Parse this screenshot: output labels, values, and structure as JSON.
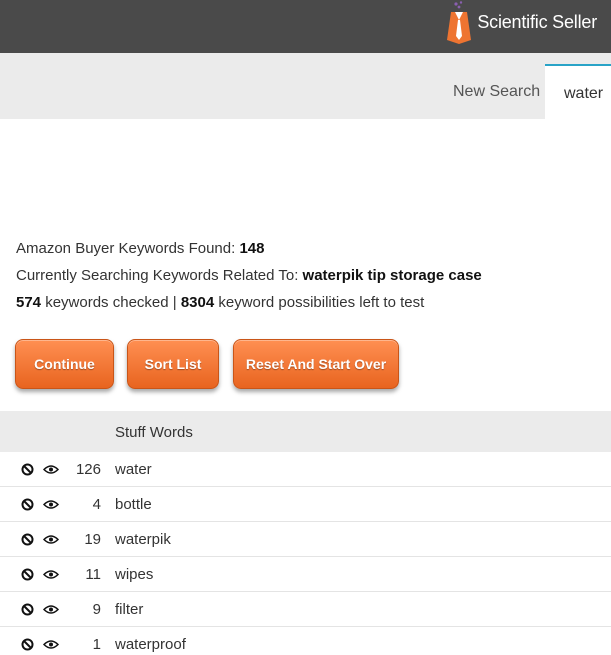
{
  "header": {
    "brand": "Scientific Seller"
  },
  "tabs": {
    "new_search": "New Search",
    "active": "water"
  },
  "status": {
    "found_label": "Amazon Buyer Keywords Found: ",
    "found_count": "148",
    "searching_label": "Currently Searching Keywords Related To: ",
    "searching_term": "waterpik tip storage case",
    "checked_count": "574",
    "checked_label": " keywords checked | ",
    "left_count": "8304",
    "left_label": " keyword possibilities left to test"
  },
  "buttons": {
    "continue": "Continue",
    "sort": "Sort List",
    "reset": "Reset And Start Over"
  },
  "table": {
    "header": "Stuff Words",
    "rows": [
      {
        "count": "126",
        "word": "water"
      },
      {
        "count": "4",
        "word": "bottle"
      },
      {
        "count": "19",
        "word": "waterpik"
      },
      {
        "count": "11",
        "word": "wipes"
      },
      {
        "count": "9",
        "word": "filter"
      },
      {
        "count": "1",
        "word": "waterproof"
      }
    ]
  },
  "icons": {
    "row_exclude": "ban-icon",
    "row_view": "eye-icon",
    "logo": "lab-coat-tie-logo"
  },
  "colors": {
    "topbar": "#4a4a4a",
    "button": "#ee7431",
    "active_tab_border": "#29a3c7"
  }
}
